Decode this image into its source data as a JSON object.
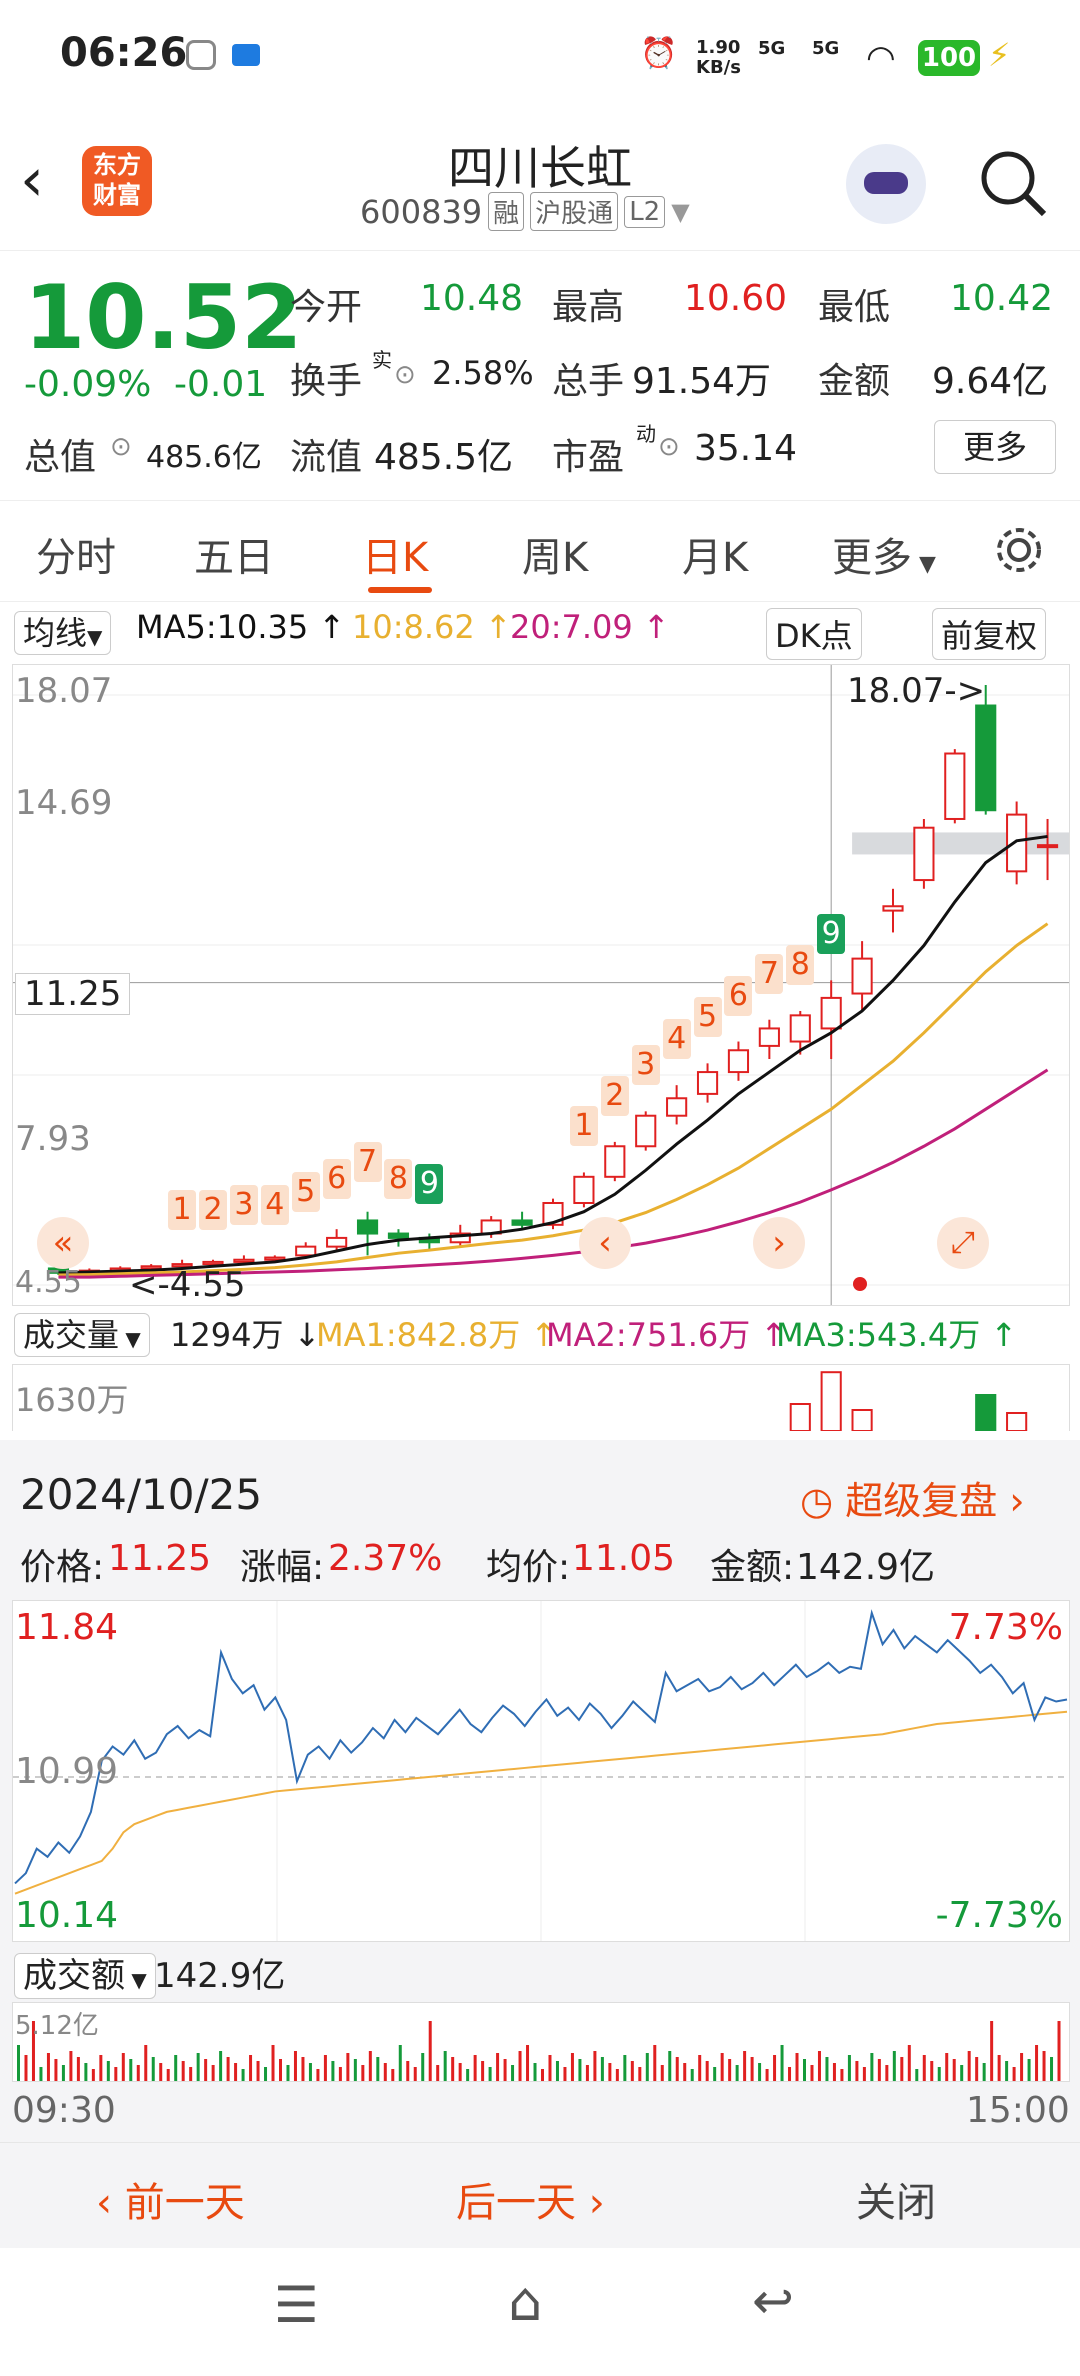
{
  "status_bar": {
    "time": "06:26",
    "net_speed_top": "1.90",
    "net_speed_bottom": "KB/s",
    "sig1": "5G",
    "sig2": "5G",
    "battery": "100"
  },
  "header": {
    "title": "四川长虹",
    "code": "600839",
    "tags": [
      "融",
      "沪股通",
      "L2"
    ],
    "logo_line1": "东方",
    "logo_line2": "财富"
  },
  "quote": {
    "price": "10.52",
    "change_pct": "-0.09%",
    "change_abs": "-0.01",
    "open_label": "今开",
    "open": "10.48",
    "high_label": "最高",
    "high": "10.60",
    "low_label": "最低",
    "low": "10.42",
    "turnover_label": "换手",
    "turnover_sup": "实",
    "turnover": "2.58%",
    "volume_label": "总手",
    "volume": "91.54万",
    "amount_label": "金额",
    "amount": "9.64亿",
    "mktcap_label": "总值",
    "mktcap": "485.6亿",
    "float_label": "流值",
    "float": "485.5亿",
    "pe_label": "市盈",
    "pe_sup": "动",
    "pe": "35.14",
    "more": "更多"
  },
  "tabs": [
    "分时",
    "五日",
    "日K",
    "周K",
    "月K",
    "更多"
  ],
  "active_tab": "日K",
  "ma_row": {
    "selector": "均线",
    "ma5": "MA5:10.35 ↑",
    "ma10": "10:8.62 ↑",
    "ma20": "20:7.09 ↑",
    "dk": "DK点",
    "adjust": "前复权"
  },
  "kchart": {
    "y_labels": [
      "18.07",
      "14.69",
      "7.93",
      "4.55"
    ],
    "crosshair_price": "11.25",
    "high_marker": "18.07->",
    "low_marker": "<-4.55",
    "seq_a": [
      "1",
      "2",
      "3",
      "4",
      "5",
      "6",
      "7",
      "8",
      "9"
    ],
    "seq_b": [
      "1",
      "2",
      "3",
      "4",
      "5",
      "6",
      "7",
      "8",
      "9"
    ]
  },
  "chart_data": {
    "type": "candlestick",
    "ylim": [
      4.55,
      18.07
    ],
    "candles": [
      {
        "o": 4.7,
        "c": 4.6,
        "h": 4.8,
        "l": 4.55
      },
      {
        "o": 4.6,
        "c": 4.65,
        "h": 4.7,
        "l": 4.55
      },
      {
        "o": 4.65,
        "c": 4.7,
        "h": 4.75,
        "l": 4.6
      },
      {
        "o": 4.7,
        "c": 4.75,
        "h": 4.8,
        "l": 4.65
      },
      {
        "o": 4.75,
        "c": 4.8,
        "h": 4.9,
        "l": 4.7
      },
      {
        "o": 4.8,
        "c": 4.85,
        "h": 4.9,
        "l": 4.75
      },
      {
        "o": 4.85,
        "c": 4.9,
        "h": 5.0,
        "l": 4.8
      },
      {
        "o": 4.9,
        "c": 4.95,
        "h": 5.0,
        "l": 4.85
      },
      {
        "o": 5.0,
        "c": 5.2,
        "h": 5.3,
        "l": 4.95
      },
      {
        "o": 5.2,
        "c": 5.4,
        "h": 5.6,
        "l": 5.1
      },
      {
        "o": 5.8,
        "c": 5.5,
        "h": 6.0,
        "l": 5.0
      },
      {
        "o": 5.5,
        "c": 5.4,
        "h": 5.6,
        "l": 5.2
      },
      {
        "o": 5.4,
        "c": 5.3,
        "h": 5.5,
        "l": 5.1
      },
      {
        "o": 5.3,
        "c": 5.5,
        "h": 5.7,
        "l": 5.2
      },
      {
        "o": 5.5,
        "c": 5.8,
        "h": 5.9,
        "l": 5.4
      },
      {
        "o": 5.8,
        "c": 5.7,
        "h": 6.0,
        "l": 5.6
      },
      {
        "o": 5.7,
        "c": 6.2,
        "h": 6.3,
        "l": 5.6
      },
      {
        "o": 6.2,
        "c": 6.8,
        "h": 6.9,
        "l": 6.1
      },
      {
        "o": 6.8,
        "c": 7.5,
        "h": 7.6,
        "l": 6.7
      },
      {
        "o": 7.5,
        "c": 8.2,
        "h": 8.3,
        "l": 7.4
      },
      {
        "o": 8.2,
        "c": 8.6,
        "h": 8.9,
        "l": 8.0
      },
      {
        "o": 8.7,
        "c": 9.2,
        "h": 9.4,
        "l": 8.5
      },
      {
        "o": 9.2,
        "c": 9.7,
        "h": 9.9,
        "l": 9.0
      },
      {
        "o": 9.8,
        "c": 10.2,
        "h": 10.4,
        "l": 9.5
      },
      {
        "o": 9.9,
        "c": 10.5,
        "h": 10.6,
        "l": 9.6
      },
      {
        "o": 10.2,
        "c": 10.9,
        "h": 11.3,
        "l": 9.5
      },
      {
        "o": 11.0,
        "c": 11.8,
        "h": 12.2,
        "l": 10.6
      },
      {
        "o": 12.9,
        "c": 13.0,
        "h": 13.4,
        "l": 12.4
      },
      {
        "o": 13.6,
        "c": 14.8,
        "h": 15.0,
        "l": 13.4
      },
      {
        "o": 15.0,
        "c": 16.5,
        "h": 16.6,
        "l": 14.9
      },
      {
        "o": 17.6,
        "c": 15.2,
        "h": 18.07,
        "l": 15.1
      },
      {
        "o": 13.8,
        "c": 15.1,
        "h": 15.4,
        "l": 13.5
      },
      {
        "o": 14.4,
        "c": 14.4,
        "h": 15.0,
        "l": 13.6
      }
    ],
    "ma5": [
      4.6,
      4.62,
      4.64,
      4.66,
      4.7,
      4.75,
      4.8,
      4.85,
      4.95,
      5.1,
      5.25,
      5.35,
      5.4,
      5.45,
      5.5,
      5.6,
      5.75,
      6.0,
      6.4,
      6.95,
      7.55,
      8.1,
      8.7,
      9.2,
      9.7,
      10.1,
      10.6,
      11.3,
      12.1,
      13.1,
      14.0,
      14.5,
      14.6
    ],
    "ma10": [
      4.55,
      4.56,
      4.58,
      4.6,
      4.62,
      4.65,
      4.68,
      4.72,
      4.78,
      4.85,
      4.95,
      5.05,
      5.12,
      5.2,
      5.28,
      5.35,
      5.45,
      5.58,
      5.75,
      5.98,
      6.28,
      6.62,
      7.0,
      7.45,
      7.9,
      8.35,
      8.9,
      9.45,
      10.1,
      10.8,
      11.5,
      12.1,
      12.6
    ],
    "ma20": [
      4.5,
      4.5,
      4.52,
      4.54,
      4.56,
      4.58,
      4.6,
      4.62,
      4.64,
      4.67,
      4.7,
      4.74,
      4.78,
      4.82,
      4.87,
      4.93,
      5.0,
      5.08,
      5.17,
      5.28,
      5.42,
      5.58,
      5.77,
      5.98,
      6.22,
      6.5,
      6.8,
      7.13,
      7.5,
      7.9,
      8.35,
      8.8,
      9.25
    ],
    "volume": [
      0,
      0,
      0,
      0,
      0,
      0,
      0,
      0,
      0,
      0,
      0,
      0,
      0,
      0,
      0,
      0,
      0,
      0,
      0,
      0,
      0,
      0,
      0,
      0,
      0.45,
      0.98,
      0.35,
      0,
      0,
      0,
      0.6,
      0.3,
      0
    ],
    "intraday_price_pct": [
      -5.5,
      -5.0,
      -3.8,
      -4.2,
      -3.5,
      -4.0,
      -3.2,
      -2.0,
      0.5,
      1.2,
      0.8,
      1.5,
      0.6,
      0.9,
      1.8,
      2.2,
      1.6,
      2.0,
      1.7,
      5.8,
      4.5,
      3.8,
      4.2,
      3.0,
      3.6,
      2.5,
      -0.5,
      0.8,
      1.2,
      0.6,
      1.5,
      0.9,
      1.4,
      2.1,
      1.6,
      2.5,
      1.9,
      2.6,
      2.2,
      1.8,
      2.4,
      3.0,
      2.3,
      1.9,
      2.6,
      3.2,
      2.8,
      2.2,
      2.9,
      3.5,
      2.7,
      3.1,
      2.5,
      3.3,
      2.8,
      2.1,
      2.7,
      3.4,
      2.9,
      2.4,
      4.8,
      3.9,
      4.2,
      4.5,
      3.9,
      4.1,
      4.6,
      4.0,
      4.3,
      4.8,
      4.2,
      4.7,
      5.2,
      4.6,
      4.9,
      5.3,
      4.8,
      5.1,
      5.0,
      7.73,
      6.2,
      6.9,
      6.0,
      6.6,
      6.2,
      5.8,
      6.4,
      5.9,
      5.4,
      4.8,
      5.2,
      4.6,
      3.8,
      4.3,
      2.5,
      3.6,
      3.4,
      3.5
    ],
    "intraday_avg_pct": [
      -6.0,
      -5.8,
      -5.6,
      -5.4,
      -5.2,
      -5.0,
      -4.8,
      -4.6,
      -4.4,
      -3.8,
      -3.0,
      -2.6,
      -2.4,
      -2.2,
      -2.0,
      -1.9,
      -1.8,
      -1.7,
      -1.6,
      -1.5,
      -1.4,
      -1.3,
      -1.2,
      -1.1,
      -1.0,
      -0.95,
      -0.9,
      -0.85,
      -0.8,
      -0.75,
      -0.7,
      -0.65,
      -0.6,
      -0.55,
      -0.5,
      -0.45,
      -0.4,
      -0.35,
      -0.3,
      -0.25,
      -0.2,
      -0.15,
      -0.1,
      -0.05,
      0.0,
      0.05,
      0.1,
      0.15,
      0.2,
      0.25,
      0.3,
      0.35,
      0.4,
      0.45,
      0.5,
      0.55,
      0.6,
      0.65,
      0.7,
      0.75,
      0.8,
      0.85,
      0.9,
      0.95,
      1.0,
      1.05,
      1.1,
      1.15,
      1.2,
      1.25,
      1.3,
      1.35,
      1.4,
      1.45,
      1.5,
      1.55,
      1.6,
      1.65,
      1.7,
      1.75,
      1.8,
      1.9,
      2.0,
      2.1,
      2.2,
      2.3,
      2.35,
      2.4,
      2.45,
      2.5,
      2.55,
      2.6,
      2.65,
      2.7,
      2.75,
      2.8,
      2.85,
      2.9
    ]
  },
  "volume_row": {
    "selector": "成交量",
    "value": "1294万 ↓",
    "ma1": "MA1:842.8万 ↑",
    "ma2": "MA2:751.6万 ↑",
    "ma3": "MA3:543.4万 ↑",
    "axis_max": "1630万"
  },
  "detail": {
    "date": "2024/10/25",
    "super_replay": "超级复盘",
    "price_label": "价格:",
    "price": "11.25",
    "chg_label": "涨幅:",
    "chg": "2.37%",
    "avg_label": "均价:",
    "avg": "11.05",
    "amt_label": "金额:",
    "amt": "142.9亿",
    "y_top": "11.84",
    "y_mid": "10.99",
    "y_bot": "10.14",
    "pct_top": "7.73%",
    "pct_bot": "-7.73%",
    "va_selector": "成交额",
    "va_value": "142.9亿",
    "va_axis": "5.12亿",
    "t_start": "09:30",
    "t_end": "15:00"
  },
  "bottom_nav": {
    "prev": "前一天",
    "next": "后一天",
    "close": "关闭"
  },
  "colors": {
    "up": "#e02020",
    "down": "#159a3a",
    "accent": "#e84a10",
    "ma5": "#111111",
    "ma10": "#e8b030",
    "ma20": "#c0207a"
  }
}
